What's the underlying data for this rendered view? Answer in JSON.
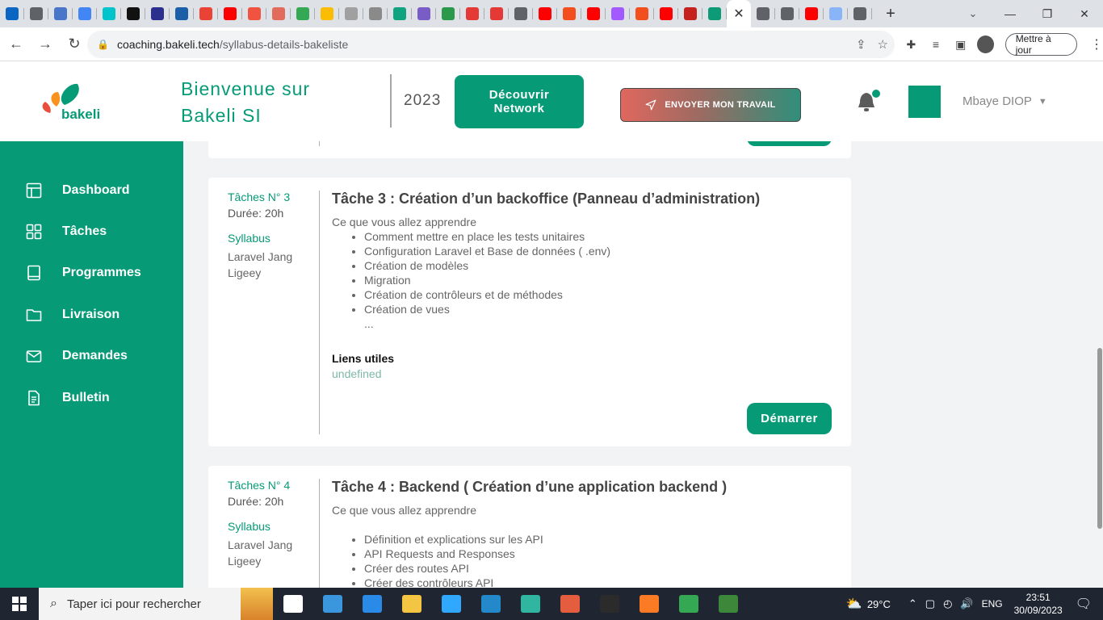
{
  "browser": {
    "tab_icons": [
      {
        "name": "linkedin-tab-icon",
        "color": "#0a66c2"
      },
      {
        "name": "tab-icon-2",
        "color": "#5f6368"
      },
      {
        "name": "tab-icon-3",
        "color": "#4a76c9"
      },
      {
        "name": "google-tab-icon",
        "color": "#4285f4"
      },
      {
        "name": "canva-tab-icon",
        "color": "#00c4cc"
      },
      {
        "name": "tiktok-tab-icon",
        "color": "#111111"
      },
      {
        "name": "tab-icon-7",
        "color": "#2b2f8e"
      },
      {
        "name": "wfp-tab-icon",
        "color": "#1a5fa8"
      },
      {
        "name": "gmail-tab-icon",
        "color": "#ea4335"
      },
      {
        "name": "youtube-tab-icon",
        "color": "#ff0000"
      },
      {
        "name": "laravel-tab-icon",
        "color": "#f05340"
      },
      {
        "name": "tab-icon-12",
        "color": "#e26b5b"
      },
      {
        "name": "drive-tab-icon",
        "color": "#34a853"
      },
      {
        "name": "drive-tab-icon-2",
        "color": "#fbbc04"
      },
      {
        "name": "tab-icon-15",
        "color": "#a0a0a0"
      },
      {
        "name": "tab-icon-16",
        "color": "#8a8a8a"
      },
      {
        "name": "chatgpt-tab-icon",
        "color": "#10a37f"
      },
      {
        "name": "tab-icon-18",
        "color": "#7a5cc6"
      },
      {
        "name": "notion-tab-icon",
        "color": "#2a9a4a"
      },
      {
        "name": "download-tab-icon",
        "color": "#e53935"
      },
      {
        "name": "download-tab-icon-2",
        "color": "#e53935"
      },
      {
        "name": "globe-tab-icon",
        "color": "#5f6368"
      },
      {
        "name": "youtube-tab-icon-2",
        "color": "#ff0000"
      },
      {
        "name": "figma-tab-icon",
        "color": "#f24e1e"
      },
      {
        "name": "youtube-tab-icon-3",
        "color": "#ff0000"
      },
      {
        "name": "figma-tab-icon-2",
        "color": "#a259ff"
      },
      {
        "name": "figma-tab-icon-3",
        "color": "#f24e1e"
      },
      {
        "name": "youtube-tab-icon-4",
        "color": "#ff0000"
      },
      {
        "name": "gmail-tab-icon-2",
        "color": "#c5221f"
      },
      {
        "name": "bakeli-tab-icon",
        "color": "#0c9a77"
      }
    ],
    "tab_icons_after": [
      {
        "name": "audio-tab-icon",
        "color": "#5f6368"
      },
      {
        "name": "globe-tab-icon-2",
        "color": "#5f6368"
      },
      {
        "name": "youtube-tab-icon-5",
        "color": "#ff0000"
      },
      {
        "name": "tab-icon-35",
        "color": "#8ab4f8"
      },
      {
        "name": "globe-tab-icon-3",
        "color": "#5f6368"
      }
    ],
    "url_host": "coaching.bakeli.tech",
    "url_path": "/syllabus-details-bakeliste",
    "update_label": "Mettre à jour"
  },
  "header": {
    "welcome_line1": "Bienvenue sur",
    "welcome_line2": "Bakeli SI",
    "logo_text": "bakeli",
    "year": "2023",
    "discover_line1": "Découvrir",
    "discover_line2": "Network",
    "send_work_label": "ENVOYER MON TRAVAIL",
    "user_name": "Mbaye DIOP"
  },
  "sidebar": {
    "items": [
      {
        "label": "Dashboard",
        "icon": "dashboard-icon"
      },
      {
        "label": "Tâches",
        "icon": "tasks-grid-icon"
      },
      {
        "label": "Programmes",
        "icon": "book-icon"
      },
      {
        "label": "Livraison",
        "icon": "folder-icon"
      },
      {
        "label": "Demandes",
        "icon": "mail-icon"
      },
      {
        "label": "Bulletin",
        "icon": "document-icon"
      }
    ]
  },
  "tasks": [
    {
      "number": "Tâches N° 3",
      "duration": "Durée: 20h",
      "syllabus_label": "Syllabus",
      "syllabus_name": "Laravel Jang Ligeey",
      "title": "Tâche 3 : Création d’un backoffice (Panneau d’administration)",
      "learn_label": "Ce que vous allez apprendre",
      "lessons": [
        "Comment mettre en place les tests unitaires",
        "Configuration Laravel et Base de données ( .env)",
        "Création de modèles",
        "Migration",
        "Création de contrôleurs et de méthodes",
        "Création de vues"
      ],
      "ellipsis": "...",
      "links_label": "Liens utiles",
      "links_value": "undefined",
      "start_label": "Démarrer"
    },
    {
      "number": "Tâches N° 4",
      "duration": "Durée: 20h",
      "syllabus_label": "Syllabus",
      "syllabus_name": "Laravel Jang Ligeey",
      "title": "Tâche 4 : Backend ( Création d’une application backend )",
      "learn_label": "Ce que vous allez apprendre",
      "lessons": [
        "Définition et explications sur les API",
        "API Requests and Responses",
        "Créer des routes API",
        "Créer des contrôleurs API"
      ]
    }
  ],
  "taskbar": {
    "search_placeholder": "Taper ici pour rechercher",
    "apps": [
      {
        "name": "task-view-icon",
        "color": "#ffffff"
      },
      {
        "name": "store-icon",
        "color": "#3a96dd"
      },
      {
        "name": "mail-app-icon",
        "color": "#2a8ae8"
      },
      {
        "name": "file-explorer-icon",
        "color": "#f4c542"
      },
      {
        "name": "photoshop-icon",
        "color": "#31a8ff"
      },
      {
        "name": "vscode-icon",
        "color": "#2489ca"
      },
      {
        "name": "edge-icon",
        "color": "#2fb5a0"
      },
      {
        "name": "git-icon",
        "color": "#e35d3e"
      },
      {
        "name": "terminal-icon",
        "color": "#2b2b2b"
      },
      {
        "name": "xampp-icon",
        "color": "#fb7a24"
      },
      {
        "name": "chrome-icon",
        "color": "#34a853"
      },
      {
        "name": "node-icon",
        "color": "#3c873a"
      }
    ],
    "weather": "29°C",
    "lang": "ENG",
    "time": "23:51",
    "date": "30/09/2023"
  },
  "colors": {
    "brand": "#069a77",
    "sidebar_bg": "#069a77"
  }
}
